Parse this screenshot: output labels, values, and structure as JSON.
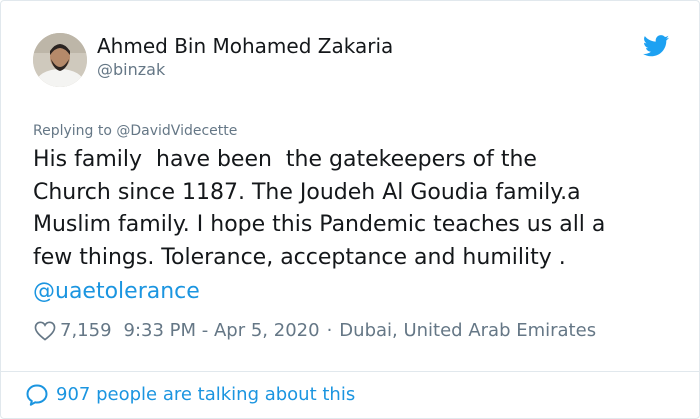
{
  "tweet": {
    "author": {
      "name": "Ahmed Bin Mohamed Zakaria",
      "handle": "@binzak"
    },
    "replying_to": "Replying to @DavidVidecette",
    "text": "His family  have been  the gatekeepers of the\nChurch since 1187. The Joudeh Al Goudia family.a\nMuslim family. I hope this Pandemic teaches us all a\nfew things. Tolerance, acceptance and humility .",
    "hashtag": "@uaetolerance",
    "likes": "7,159",
    "timestamp": "9:33 PM - Apr 5, 2020",
    "separator": "·",
    "location": "Dubai, United Arab Emirates",
    "talking": "907 people are talking about this"
  },
  "colors": {
    "brand_blue": "#1da1f2",
    "link_blue": "#1b95e0",
    "muted_gray": "#657786",
    "text": "#14171a"
  },
  "icons": [
    "avatar",
    "twitter-bird-icon",
    "heart-icon",
    "speech-bubble-icon"
  ]
}
